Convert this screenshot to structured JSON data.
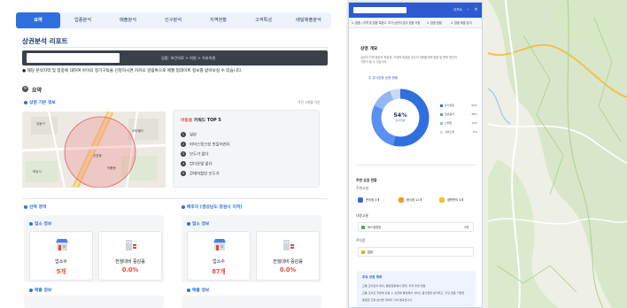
{
  "report": {
    "tabs": [
      "요약",
      "업종분석",
      "매출분석",
      "인구분석",
      "지역현황",
      "고객특성",
      "배달매출분석"
    ],
    "active_tab": "요약",
    "title": "상권분석 리포트",
    "address_suffix": "업종: 보건의료 > 의원 > 치과의원",
    "notice": "● 해당 분석지역 및 업종에 대하여 아이의 정기구독을 신청하시면 카카오 알림톡으로 매월 업데이트 정보를 받아보실 수 있습니다.",
    "summary_title": "요약",
    "basic_info_title": "상권 기본 정보",
    "basic_info_note": "직전 3개월 기준",
    "keyword_title_red": "아동용",
    "keyword_title_rest": " 키워드 TOP 5",
    "keywords": [
      {
        "n": "1",
        "text": "일본"
      },
      {
        "n": "2",
        "text": "아이스링크장 만들어진다"
      },
      {
        "n": "3",
        "text": "모두가 없다"
      },
      {
        "n": "4",
        "text": "런다운빛 없다"
      },
      {
        "n": "5",
        "text": "콘테이블린 모두가"
      }
    ],
    "map_labels": [
      "하남시",
      "신장동",
      "덕풍동",
      "스타필드",
      "강동구"
    ],
    "left_column_title": "선택 영역",
    "right_column_title": "배후지 (경상남도 창원시 지역)",
    "store_info_title": "업소 정보",
    "sales_info_title": "매출 정보",
    "left_cards": [
      {
        "label": "업소수",
        "value": "5개",
        "icon": "store-icon"
      },
      {
        "label": "전월대비 증감률",
        "value": "0.0%",
        "icon": "building-chart-icon"
      }
    ],
    "right_cards": [
      {
        "label": "업소수",
        "value": "87개",
        "icon": "store-icon"
      },
      {
        "label": "전월대비 증감률",
        "value": "0.0%",
        "icon": "building-chart-icon"
      }
    ]
  },
  "side_panel": {
    "header_right": "리포트",
    "steps": [
      "1. 업종 / 지역 및 업종 특정",
      "2. 지가 상권의 분석 업종 지정",
      "3. 업종 현황",
      "4. 업종 매출 분석"
    ],
    "title": "상권 개요",
    "text_lines": [
      "상권의 지역 평균적 특징적, 거래적 특징을 업소의 대체탐색에 업종 및 면적 판단의",
      "기준이 될 수 있습니다."
    ],
    "donut_caption": "주 유사업종 상권 현황",
    "donut_value": "54%",
    "donut_sub": "유사업종",
    "legend": [
      {
        "label": "유사업종",
        "value": "54%",
        "color": "#2f6fde"
      },
      {
        "label": "일반음식",
        "value": "28%",
        "color": "#5b8ff0"
      },
      {
        "label": "소매업",
        "value": "12%",
        "color": "#93b6f6"
      },
      {
        "label": "서비스업",
        "value": "6%",
        "color": "#c9daf9"
      }
    ],
    "chart_data": {
      "type": "pie",
      "values": [
        54,
        28,
        12,
        6
      ],
      "categories": [
        "유사업종",
        "일반음식",
        "소매업",
        "서비스업"
      ]
    },
    "section_a": "주변 상권 현황",
    "section_a_sub": "주변시설",
    "chips": [
      {
        "label": "편의점",
        "count": "3개",
        "color": "#3a66d9"
      },
      {
        "label": "음식점",
        "count": "12개",
        "color": "#f09a2b"
      },
      {
        "label": "생활편의",
        "count": "4개",
        "color": "#f2c230"
      }
    ],
    "section_b": "대중교통",
    "field_1": "버스정류장",
    "field_1_right": "3개",
    "section_c": "주차장",
    "field_2": "없음",
    "blue_title": "주요 상권 정보",
    "blue_lines": [
      "교통 교차로의 위치, 통일업종에서 현대, 지역 주변 업종",
      "교통 교차로 주변에 유동 수 상권에 통일해서 서비스 음식업을 분석하고, 주요 업종 기업을",
      "종합한 조회 분석을 데이터 기여 결과입니다."
    ]
  }
}
